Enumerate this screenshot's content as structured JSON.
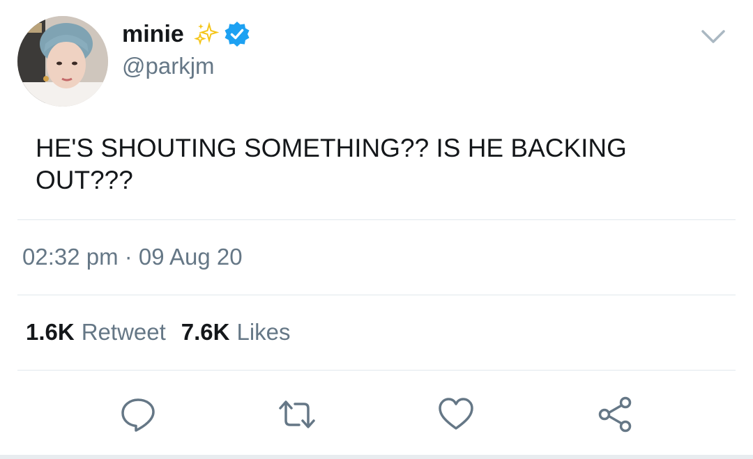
{
  "user": {
    "display_name": "minie",
    "handle": "@parkjm",
    "verified": true,
    "name_emoji": "sparkles-icon",
    "avatar_icon": "avatar"
  },
  "tweet": {
    "text": "HE'S SHOUTING SOMETHING?? IS HE BACKING\nOUT???",
    "timestamp": "02:32 pm · 09 Aug 20"
  },
  "stats": {
    "retweets_count": "1.6K",
    "retweets_label": "Retweet",
    "likes_count": "7.6K",
    "likes_label": "Likes"
  },
  "actions": [
    {
      "name": "reply",
      "icon": "reply-icon"
    },
    {
      "name": "retweet",
      "icon": "retweet-icon"
    },
    {
      "name": "like",
      "icon": "heart-icon"
    },
    {
      "name": "share",
      "icon": "share-icon"
    }
  ],
  "colors": {
    "primary_text": "#14171a",
    "secondary_text": "#657786",
    "verified_blue": "#1da1f2",
    "sparkle_gold": "#f5c518",
    "divider": "#e1e8ed"
  }
}
